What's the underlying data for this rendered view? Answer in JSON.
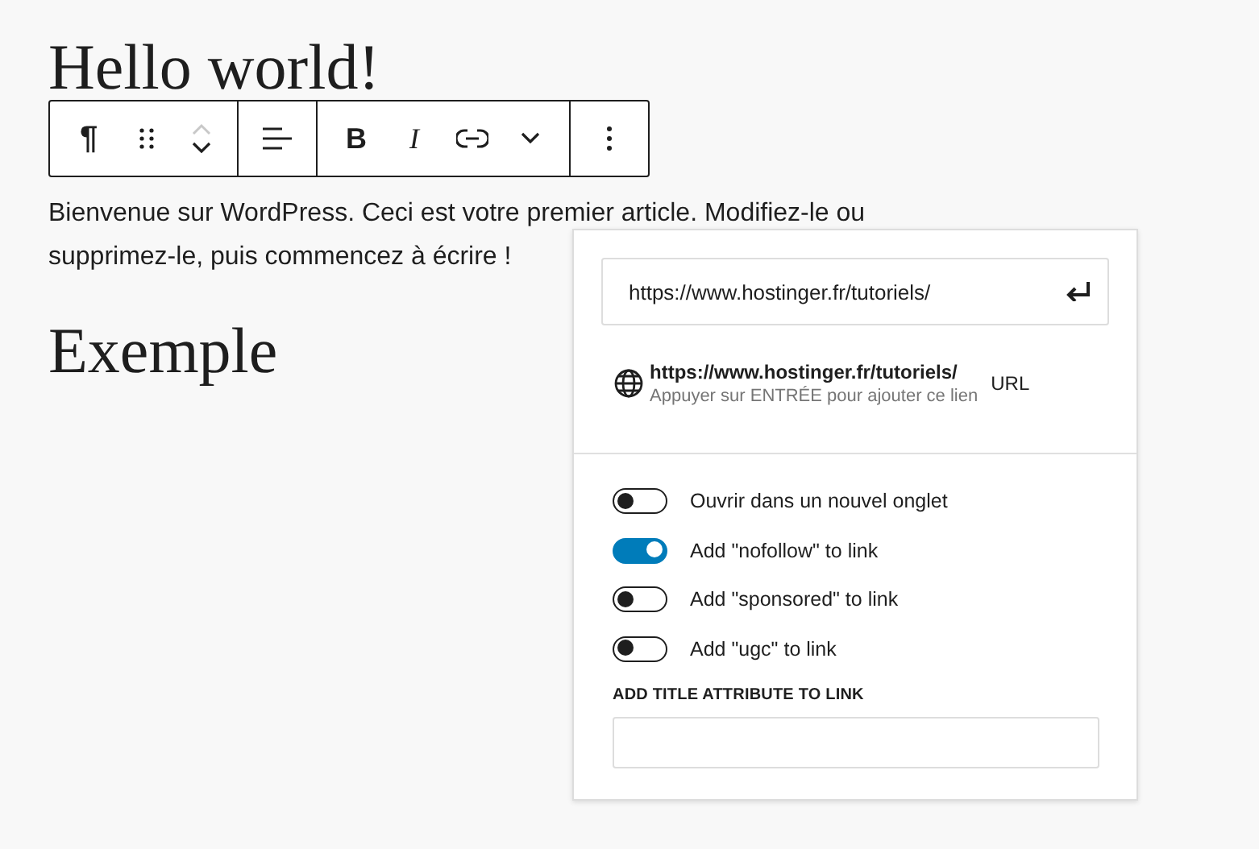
{
  "post": {
    "title": "Hello world!",
    "paragraph": "Bienvenue sur WordPress. Ceci est votre premier article. Modifiez-le ou supprimez-le, puis commencez à écrire !",
    "heading": "Exemple"
  },
  "toolbar": {
    "groups": [
      [
        {
          "kind": "symbol",
          "label": "¶"
        },
        {
          "kind": "drag"
        },
        {
          "kind": "move"
        }
      ],
      [
        {
          "kind": "align"
        }
      ],
      [
        {
          "kind": "bold",
          "label": "B"
        },
        {
          "kind": "italic",
          "label": "I"
        },
        {
          "kind": "link"
        },
        {
          "kind": "chevron"
        }
      ],
      [
        {
          "kind": "options"
        }
      ]
    ]
  },
  "link_popup": {
    "url": "https://www.hostinger.fr/tutoriels/",
    "suggestion": {
      "title": "https://www.hostinger.fr/tutoriels/",
      "hint": "Appuyer sur ENTRÉE pour ajouter ce lien",
      "type": "URL"
    },
    "toggles": [
      {
        "label": "Ouvrir dans un nouvel onglet",
        "on": false
      },
      {
        "label": "Add \"nofollow\" to link",
        "on": true
      },
      {
        "label": "Add \"sponsored\" to link",
        "on": false
      },
      {
        "label": "Add \"ugc\" to link",
        "on": false
      }
    ],
    "title_attribute_label": "ADD TITLE ATTRIBUTE TO LINK"
  }
}
